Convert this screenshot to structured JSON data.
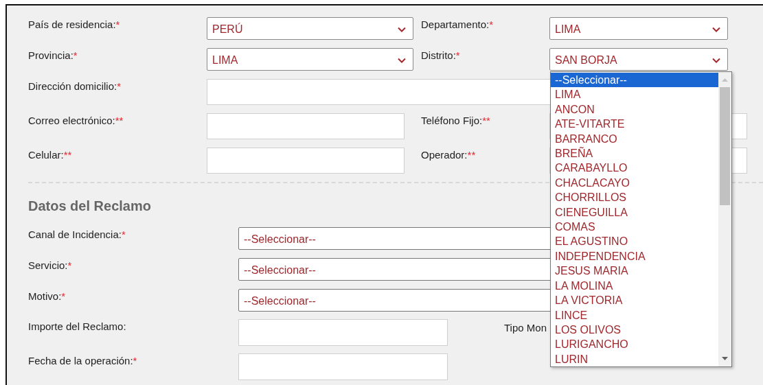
{
  "personal": {
    "rows": [
      {
        "fields": [
          {
            "label": "País de residencia:",
            "required": "*",
            "kind": "select",
            "value": "PERÚ"
          },
          {
            "label": "Departamento:",
            "required": "*",
            "kind": "select",
            "value": "LIMA"
          }
        ]
      },
      {
        "fields": [
          {
            "label": "Provincia:",
            "required": "*",
            "kind": "select",
            "value": "LIMA"
          },
          {
            "label": "Distrito:",
            "required": "*",
            "kind": "select",
            "value": "SAN BORJA",
            "open": true,
            "options": [
              {
                "text": "--Seleccionar--",
                "selected": true
              },
              {
                "text": "LIMA",
                "selected": false
              },
              {
                "text": "ANCON",
                "selected": false
              },
              {
                "text": "ATE-VITARTE",
                "selected": false
              },
              {
                "text": "BARRANCO",
                "selected": false
              },
              {
                "text": "BREÑA",
                "selected": false
              },
              {
                "text": "CARABAYLLO",
                "selected": false
              },
              {
                "text": "CHACLACAYO",
                "selected": false
              },
              {
                "text": "CHORRILLOS",
                "selected": false
              },
              {
                "text": "CIENEGUILLA",
                "selected": false
              },
              {
                "text": "COMAS",
                "selected": false
              },
              {
                "text": "EL AGUSTINO",
                "selected": false
              },
              {
                "text": "INDEPENDENCIA",
                "selected": false
              },
              {
                "text": "JESUS MARIA",
                "selected": false
              },
              {
                "text": "LA MOLINA",
                "selected": false
              },
              {
                "text": "LA VICTORIA",
                "selected": false
              },
              {
                "text": "LINCE",
                "selected": false
              },
              {
                "text": "LOS OLIVOS",
                "selected": false
              },
              {
                "text": "LURIGANCHO",
                "selected": false
              },
              {
                "text": "LURIN",
                "selected": false
              }
            ]
          }
        ]
      },
      {
        "fields": [
          {
            "label": "Dirección domicilio:",
            "required": "*",
            "kind": "wide_input"
          }
        ]
      },
      {
        "fields": [
          {
            "label": "Correo electrónico:",
            "required": "**",
            "kind": "input"
          },
          {
            "label": "Teléfono Fijo:",
            "required": "**",
            "kind": "input"
          }
        ]
      },
      {
        "fields": [
          {
            "label": "Celular:",
            "required": "**",
            "kind": "input"
          },
          {
            "label": "Operador:",
            "required": "**",
            "kind": "input"
          }
        ]
      }
    ]
  },
  "reclamo": {
    "title": "Datos del Reclamo",
    "rows": [
      {
        "label": "Canal de Incidencia:",
        "required": "*",
        "kind": "select",
        "value": "--Seleccionar--"
      },
      {
        "label": "Servicio:",
        "required": "*",
        "kind": "select",
        "value": "--Seleccionar--"
      },
      {
        "label": "Motivo:",
        "required": "*",
        "kind": "select",
        "value": "--Seleccionar--"
      },
      {
        "label": "Importe del Reclamo:",
        "kind": "input",
        "side_label": "Tipo Mon"
      },
      {
        "label": "Fecha de la operación:",
        "required": "*",
        "kind": "input"
      }
    ]
  }
}
